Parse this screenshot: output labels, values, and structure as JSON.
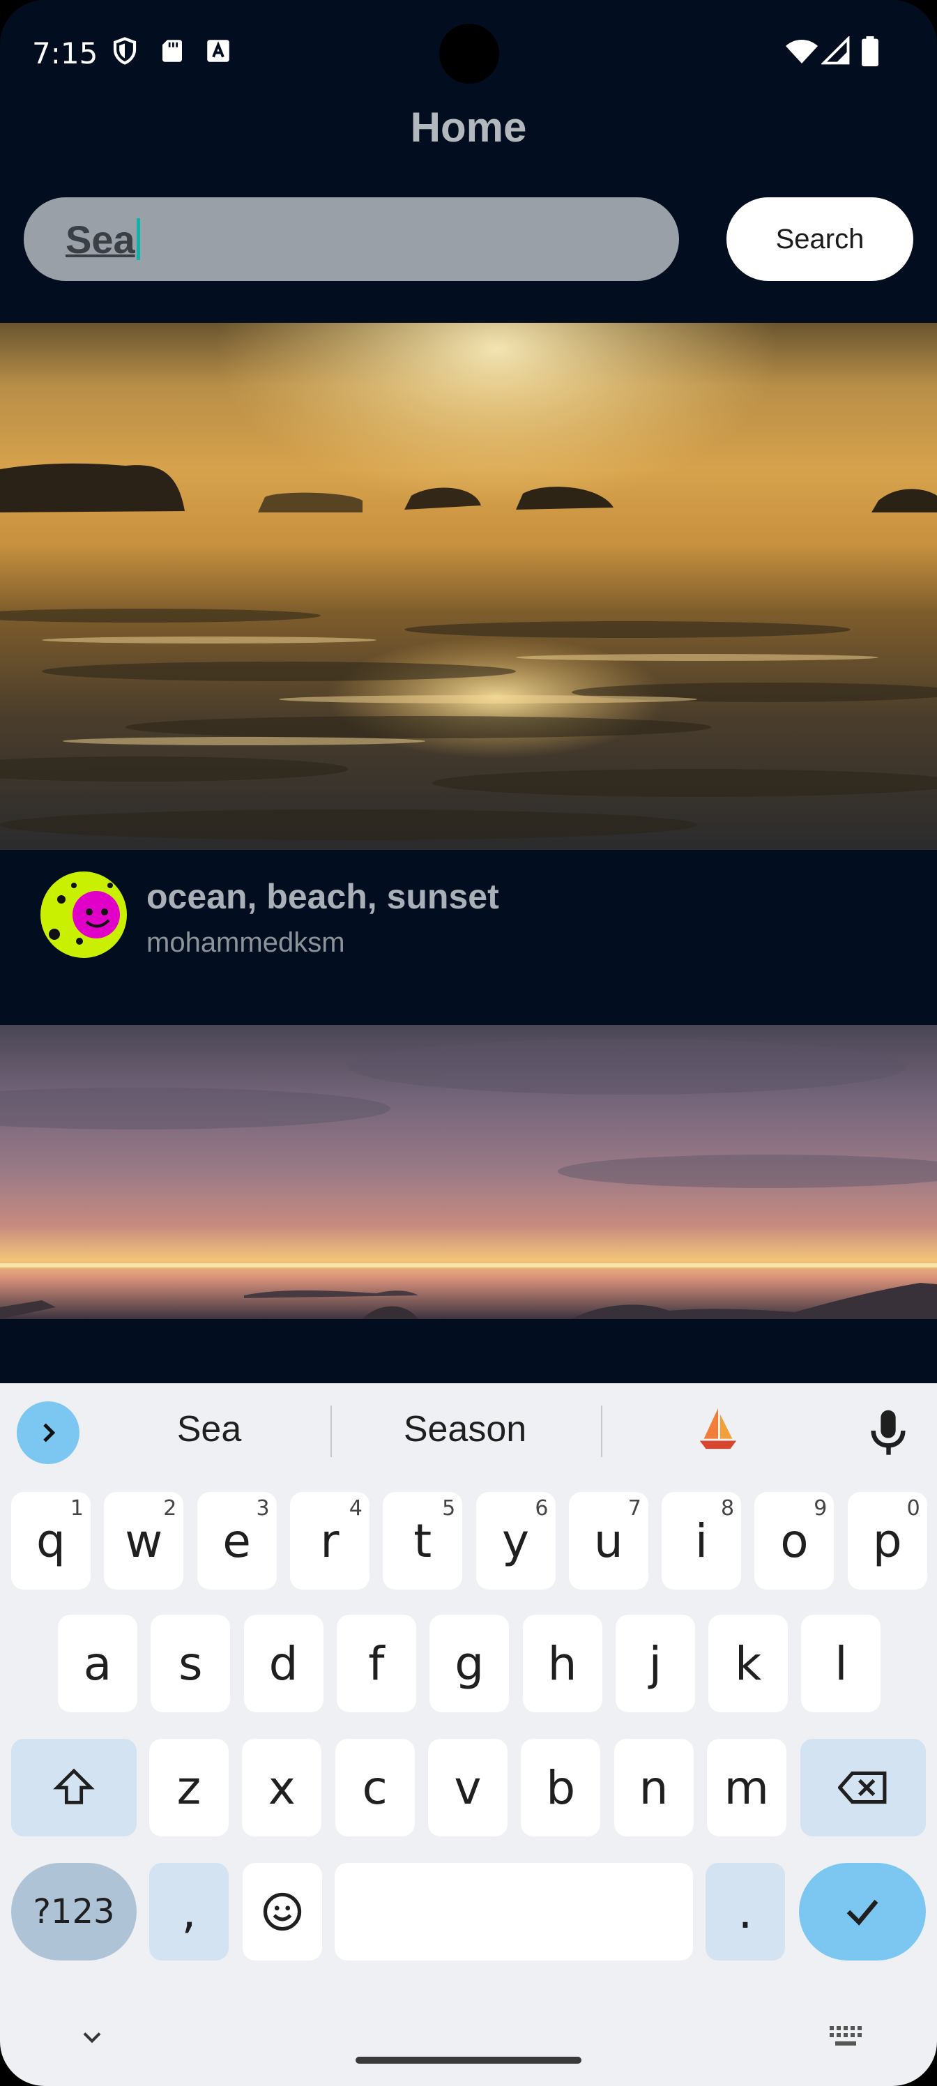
{
  "status_bar": {
    "time": "7:15",
    "left_icons": [
      "shield-icon",
      "sd-card-icon",
      "font-a-icon"
    ],
    "right_icons": [
      "wifi-icon",
      "signal-icon",
      "battery-icon"
    ]
  },
  "header": {
    "title": "Home"
  },
  "search": {
    "value": "Sea",
    "button_label": "Search"
  },
  "posts": [
    {
      "tags": "ocean, beach, sunset",
      "author": "mohammedksm",
      "image": "sunset-over-ocean-photo"
    },
    {
      "image": "pink-sunset-sky-photo"
    }
  ],
  "keyboard": {
    "suggestions": [
      "Sea",
      "Season"
    ],
    "emoji_suggestion": "sailboat-emoji",
    "row1": [
      {
        "k": "q",
        "h": "1"
      },
      {
        "k": "w",
        "h": "2"
      },
      {
        "k": "e",
        "h": "3"
      },
      {
        "k": "r",
        "h": "4"
      },
      {
        "k": "t",
        "h": "5"
      },
      {
        "k": "y",
        "h": "6"
      },
      {
        "k": "u",
        "h": "7"
      },
      {
        "k": "i",
        "h": "8"
      },
      {
        "k": "o",
        "h": "9"
      },
      {
        "k": "p",
        "h": "0"
      }
    ],
    "row2": [
      "a",
      "s",
      "d",
      "f",
      "g",
      "h",
      "j",
      "k",
      "l"
    ],
    "row3": [
      "z",
      "x",
      "c",
      "v",
      "b",
      "n",
      "m"
    ],
    "symbols_label": "?123",
    "comma_label": ",",
    "period_label": "."
  },
  "colors": {
    "background": "#020e1f",
    "accent": "#7cc7f2",
    "caret": "#0fb3a8"
  }
}
